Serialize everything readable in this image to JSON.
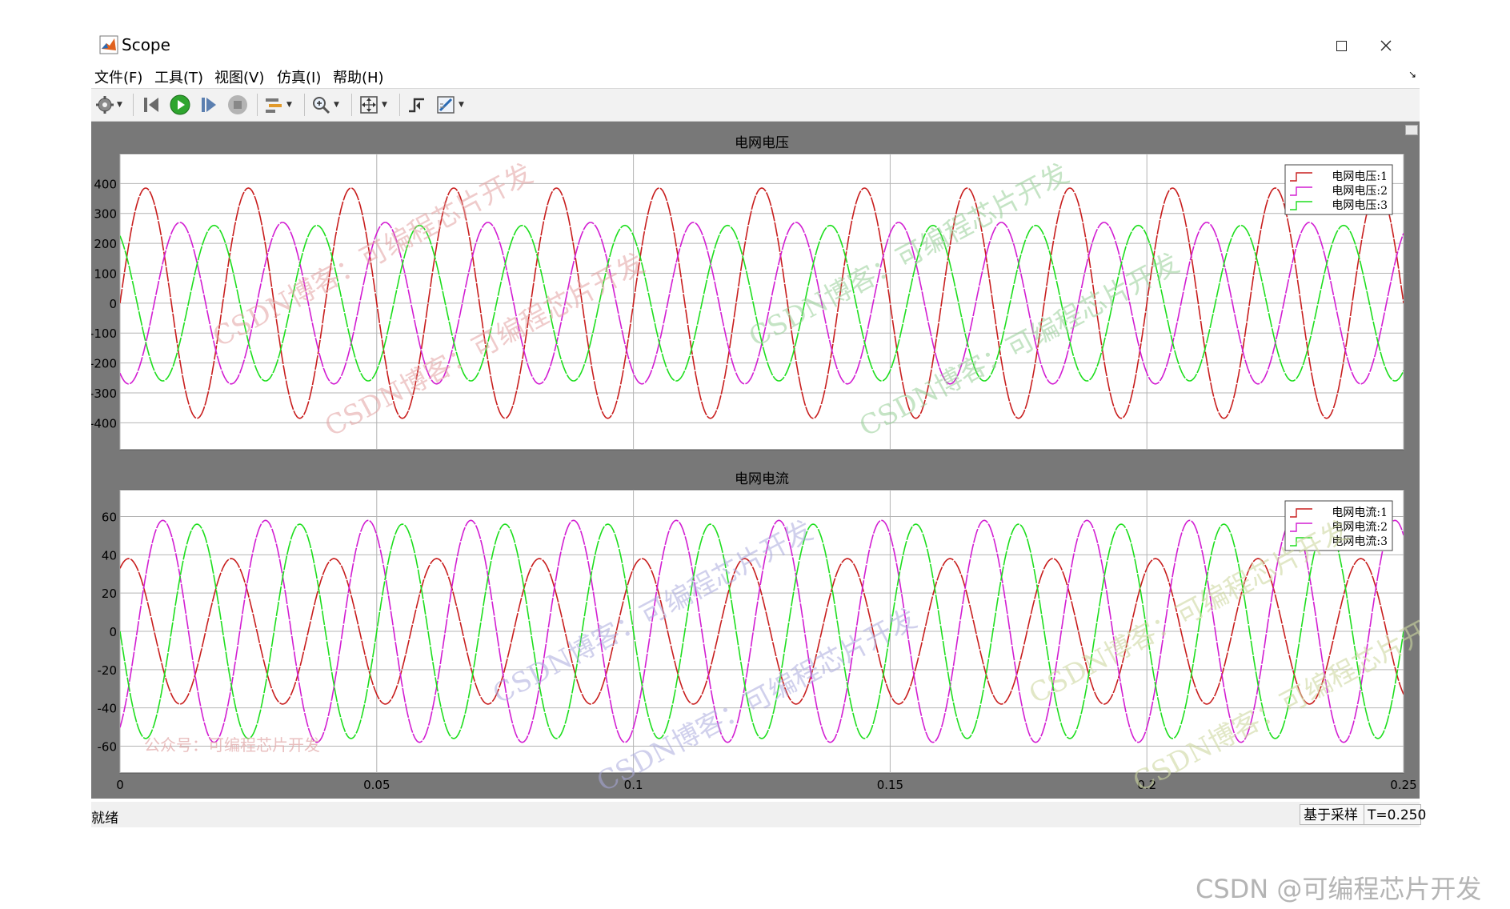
{
  "window": {
    "title": "Scope",
    "minimize_icon": "minimize-icon",
    "maximize_icon": "maximize-icon",
    "close_icon": "close-icon"
  },
  "menu": [
    {
      "label": "文件(F)"
    },
    {
      "label": "工具(T)"
    },
    {
      "label": "视图(V)"
    },
    {
      "label": "仿真(I)"
    },
    {
      "label": "帮助(H)"
    }
  ],
  "toolbar": {
    "items": [
      {
        "icon": "settings-gear-icon"
      },
      {
        "icon": "step-back-icon"
      },
      {
        "icon": "run-icon"
      },
      {
        "icon": "step-forward-icon"
      },
      {
        "icon": "stop-icon"
      },
      {
        "icon": "signal-highlight-icon"
      },
      {
        "icon": "zoom-in-icon"
      },
      {
        "icon": "fit-axes-icon"
      },
      {
        "icon": "trigger-icon"
      },
      {
        "icon": "measurement-icon"
      }
    ]
  },
  "colors": {
    "phase1": "#c81e1e",
    "phase2": "#d21ed2",
    "phase3": "#1ede1e",
    "frame": "#787878",
    "plot_bg": "#ffffff",
    "grid": "#b4b4b4"
  },
  "chart_data": [
    {
      "type": "line",
      "title": "电网电压",
      "xlim": [
        0,
        0.25
      ],
      "ylim": [
        -490,
        500
      ],
      "yticks": [
        400,
        300,
        200,
        100,
        0,
        -100,
        -200,
        -300,
        -400
      ],
      "xticks": [
        0,
        0.05,
        0.1,
        0.15,
        0.2,
        0.25
      ],
      "grid": true,
      "legend_position": "top-right",
      "series": [
        {
          "name": "电网电压:1",
          "color": "#c81e1e",
          "amplitude": 385,
          "frequency_hz": 50,
          "phase_deg": 0
        },
        {
          "name": "电网电压:2",
          "color": "#d21ed2",
          "amplitude": 270,
          "frequency_hz": 50,
          "phase_deg": -120
        },
        {
          "name": "电网电压:3",
          "color": "#1ede1e",
          "amplitude": 260,
          "frequency_hz": 50,
          "phase_deg": 120
        }
      ]
    },
    {
      "type": "line",
      "title": "电网电流",
      "xlim": [
        0,
        0.25
      ],
      "ylim": [
        -74,
        74
      ],
      "yticks": [
        60,
        40,
        20,
        0,
        -20,
        -40,
        -60
      ],
      "xticks": [
        0,
        0.05,
        0.1,
        0.15,
        0.2,
        0.25
      ],
      "grid": true,
      "legend_position": "top-right",
      "series": [
        {
          "name": "电网电流:1",
          "color": "#c81e1e",
          "amplitude": 38,
          "frequency_hz": 50,
          "phase_deg": 60
        },
        {
          "name": "电网电流:2",
          "color": "#d21ed2",
          "amplitude": 58,
          "frequency_hz": 50,
          "phase_deg": -60
        },
        {
          "name": "电网电流:3",
          "color": "#1ede1e",
          "amplitude": 56,
          "frequency_hz": 50,
          "phase_deg": 180
        }
      ]
    }
  ],
  "watermarks": [
    "CSDN博客：可编程芯片开发",
    "公众号：可编程芯片开发"
  ],
  "status": {
    "text": "就绪",
    "sample_mode": "基于采样",
    "time": "T=0.250"
  },
  "footer": {
    "watermark": "CSDN @可编程芯片开发"
  }
}
